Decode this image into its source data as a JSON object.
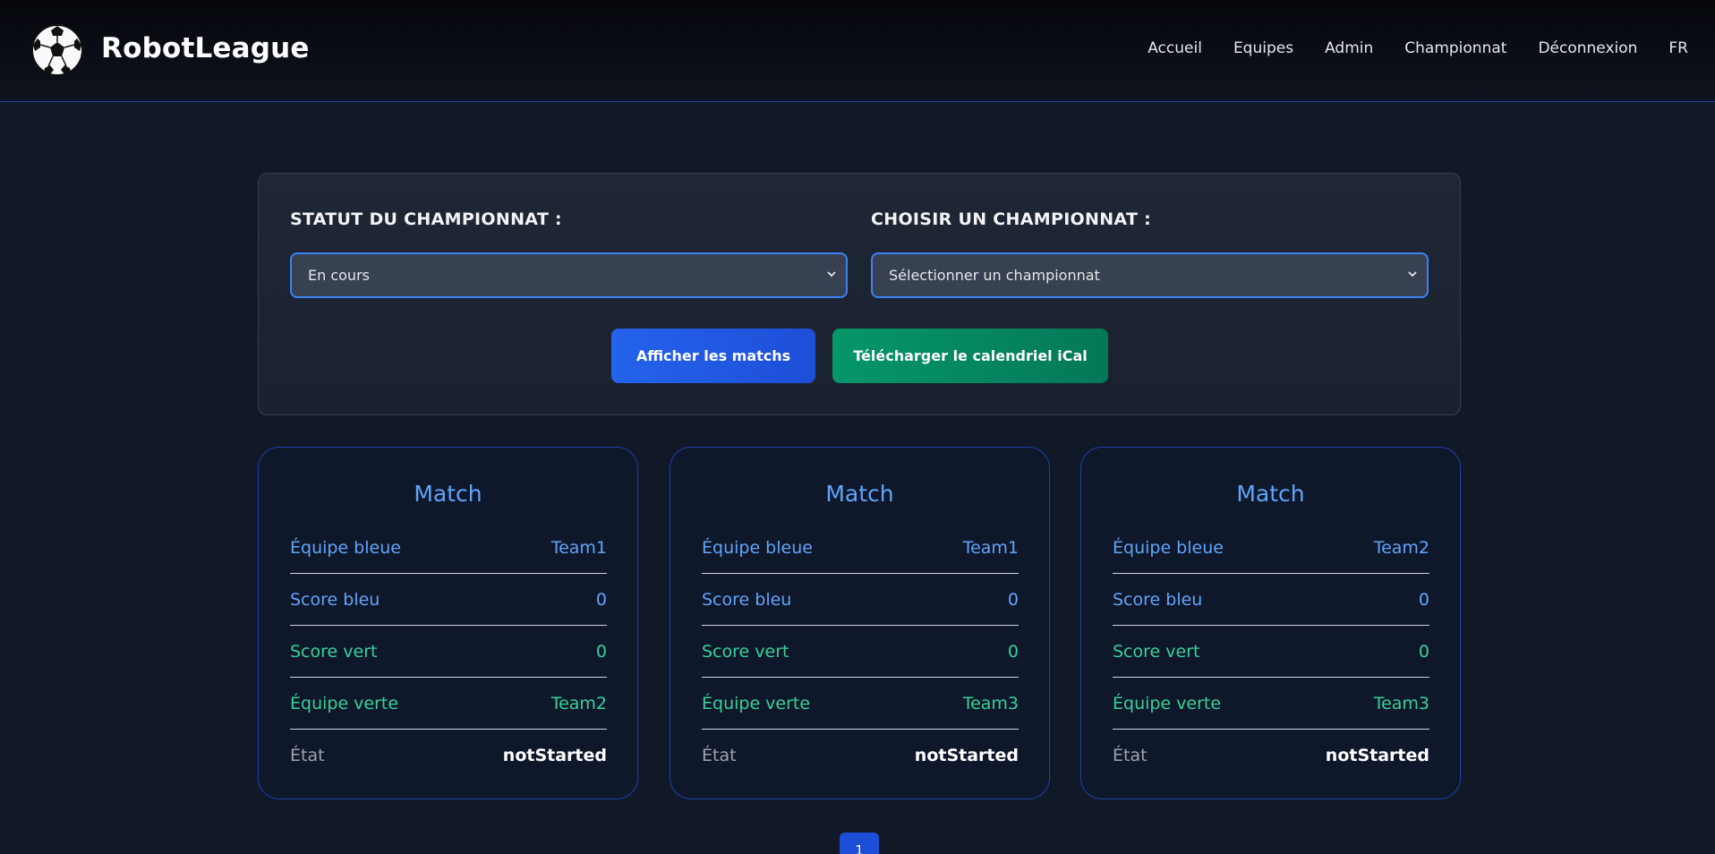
{
  "header": {
    "brand": "RobotLeague",
    "logo_icon": "soccer-ball-icon",
    "nav": [
      {
        "label": "Accueil"
      },
      {
        "label": "Equipes"
      },
      {
        "label": "Admin"
      },
      {
        "label": "Championnat"
      },
      {
        "label": "Déconnexion"
      },
      {
        "label": "FR"
      }
    ]
  },
  "filters": {
    "status_label": "STATUT DU CHAMPIONNAT :",
    "status_value": "En cours",
    "championship_label": "CHOISIR UN CHAMPIONNAT :",
    "championship_value": "Sélectionner un championnat",
    "show_button": "Afficher les matchs",
    "ical_button": "Télécharger le calendriel iCal"
  },
  "labels": {
    "card_title": "Match",
    "blue_team": "Équipe bleue",
    "blue_score": "Score bleu",
    "green_score": "Score vert",
    "green_team": "Équipe verte",
    "state": "État"
  },
  "matches": [
    {
      "blue_team": "Team1",
      "blue_score": "0",
      "green_score": "0",
      "green_team": "Team2",
      "state": "notStarted"
    },
    {
      "blue_team": "Team1",
      "blue_score": "0",
      "green_score": "0",
      "green_team": "Team3",
      "state": "notStarted"
    },
    {
      "blue_team": "Team2",
      "blue_score": "0",
      "green_score": "0",
      "green_team": "Team3",
      "state": "notStarted"
    }
  ],
  "pagination": {
    "current_page": "1"
  },
  "colors": {
    "accent_blue": "#60a5fa",
    "accent_green": "#34d399",
    "primary_button": "#2563eb",
    "secondary_button": "#059669",
    "background": "#111827"
  }
}
